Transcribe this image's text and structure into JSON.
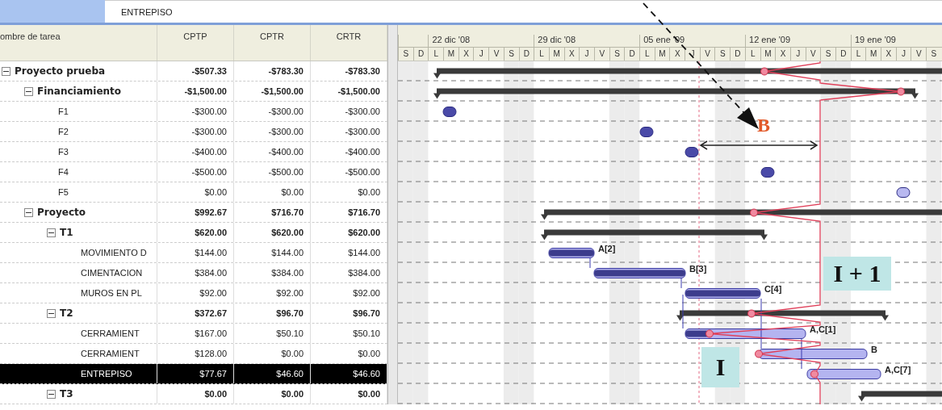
{
  "entry_bar": {
    "value": "ENTREPISO"
  },
  "columns": [
    "ombre de tarea",
    "CPTP",
    "CPTR",
    "CRTR"
  ],
  "timescale": {
    "weeks": [
      "22 dic '08",
      "29 dic '08",
      "05 ene '09",
      "12 ene '09",
      "19 ene '09"
    ],
    "days": [
      "S",
      "D",
      "L",
      "M",
      "X",
      "J",
      "V",
      "S",
      "D",
      "L",
      "M",
      "X",
      "J",
      "V",
      "S",
      "D",
      "L",
      "M",
      "X",
      "J",
      "V",
      "S",
      "D",
      "L",
      "M",
      "X",
      "J",
      "V",
      "S",
      "D",
      "L",
      "M",
      "X",
      "J",
      "V",
      "S"
    ]
  },
  "tasks": [
    {
      "name": "Proyecto prueba",
      "kind": "summary",
      "expanded": true,
      "selected": false,
      "cptp": "-$507.33",
      "cptr": "-$783.30",
      "crtr": "-$783.30",
      "children": [
        {
          "name": "Financiamiento",
          "kind": "summary",
          "expanded": true,
          "selected": false,
          "cptp": "-$1,500.00",
          "cptr": "-$1,500.00",
          "crtr": "-$1,500.00",
          "children": [
            {
              "name": "F1",
              "kind": "task",
              "selected": false,
              "cptp": "-$300.00",
              "cptr": "-$300.00",
              "crtr": "-$300.00"
            },
            {
              "name": "F2",
              "kind": "task",
              "selected": false,
              "cptp": "-$300.00",
              "cptr": "-$300.00",
              "crtr": "-$300.00"
            },
            {
              "name": "F3",
              "kind": "task",
              "selected": false,
              "cptp": "-$400.00",
              "cptr": "-$400.00",
              "crtr": "-$400.00"
            },
            {
              "name": "F4",
              "kind": "task",
              "selected": false,
              "cptp": "-$500.00",
              "cptr": "-$500.00",
              "crtr": "-$500.00"
            },
            {
              "name": "F5",
              "kind": "task",
              "selected": false,
              "cptp": "$0.00",
              "cptr": "$0.00",
              "crtr": "$0.00"
            }
          ]
        },
        {
          "name": "Proyecto",
          "kind": "summary",
          "expanded": true,
          "selected": false,
          "cptp": "$992.67",
          "cptr": "$716.70",
          "crtr": "$716.70",
          "children": [
            {
              "name": "T1",
              "kind": "summary",
              "expanded": true,
              "selected": false,
              "cptp": "$620.00",
              "cptr": "$620.00",
              "crtr": "$620.00",
              "children": [
                {
                  "name": "MOVIMIENTO D",
                  "kind": "task",
                  "selected": false,
                  "cptp": "$144.00",
                  "cptr": "$144.00",
                  "crtr": "$144.00",
                  "bar_label": "A[2]"
                },
                {
                  "name": "CIMENTACION",
                  "kind": "task",
                  "selected": false,
                  "cptp": "$384.00",
                  "cptr": "$384.00",
                  "crtr": "$384.00",
                  "bar_label": "B[3]"
                },
                {
                  "name": "MUROS EN PL",
                  "kind": "task",
                  "selected": false,
                  "cptp": "$92.00",
                  "cptr": "$92.00",
                  "crtr": "$92.00",
                  "bar_label": "C[4]"
                }
              ]
            },
            {
              "name": "T2",
              "kind": "summary",
              "expanded": true,
              "selected": false,
              "cptp": "$372.67",
              "cptr": "$96.70",
              "crtr": "$96.70",
              "children": [
                {
                  "name": "CERRAMIENT",
                  "kind": "task",
                  "selected": false,
                  "cptp": "$167.00",
                  "cptr": "$50.10",
                  "crtr": "$50.10",
                  "bar_label": "A,C[1]"
                },
                {
                  "name": "CERRAMIENT",
                  "kind": "task",
                  "selected": false,
                  "cptp": "$128.00",
                  "cptr": "$0.00",
                  "crtr": "$0.00",
                  "bar_label": "B"
                },
                {
                  "name": "ENTREPISO",
                  "kind": "task",
                  "selected": true,
                  "cptp": "$77.67",
                  "cptr": "$46.60",
                  "crtr": "$46.60",
                  "bar_label": "A,C[7]"
                }
              ]
            },
            {
              "name": "T3",
              "kind": "summary",
              "expanded": true,
              "selected": false,
              "cptp": "$0.00",
              "cptr": "$0.00",
              "crtr": "$0.00"
            }
          ]
        }
      ]
    }
  ],
  "annotations": [
    {
      "kind": "letter",
      "text": "B"
    },
    {
      "kind": "box",
      "text": "I + 1"
    },
    {
      "kind": "box",
      "text": "I"
    }
  ]
}
